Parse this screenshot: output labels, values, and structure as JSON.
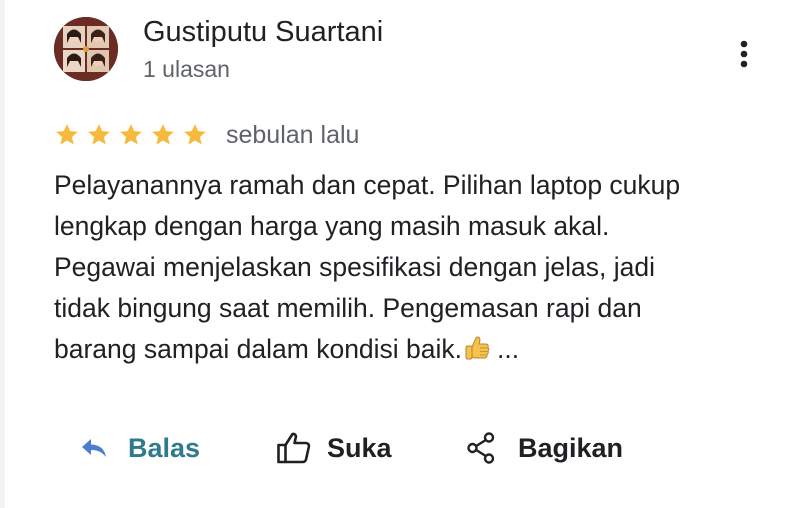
{
  "reviewer": {
    "name": "Gustiputu Suartani",
    "review_count": "1 ulasan"
  },
  "rating": {
    "stars": 5,
    "max": 5,
    "date": "sebulan lalu",
    "star_color": "#f5b93c"
  },
  "review": {
    "lines": [
      "Pelayanannya ramah dan cepat. Pilihan laptop cukup",
      "lengkap dengan harga yang masih masuk akal.",
      "Pegawai menjelaskan spesifikasi dengan jelas, jadi",
      "tidak bingung saat memilih. Pengemasan rapi dan",
      "barang sampai dalam kondisi baik."
    ],
    "ellipsis": "...",
    "emoji": "thumbs-up"
  },
  "actions": {
    "reply_label": "Balas",
    "like_label": "Suka",
    "share_label": "Bagikan",
    "reply_color": "#2f7a8c"
  },
  "icons": {
    "more": "more-vert-icon",
    "reply": "reply-arrow-icon",
    "like": "thumb-up-outline-icon",
    "share": "share-icon"
  }
}
